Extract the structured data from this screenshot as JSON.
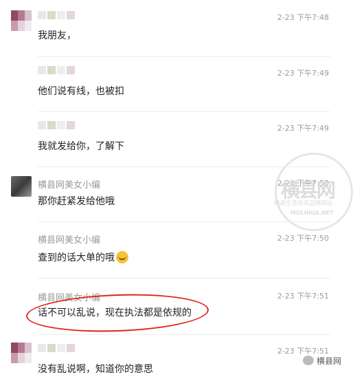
{
  "messages": [
    {
      "name": "",
      "time": "2-23 下午7:48",
      "text": "我朋友，",
      "avatar": "pixelated"
    },
    {
      "name": "",
      "time": "2-23 下午7:49",
      "text": "他们说有线，也被扣"
    },
    {
      "name": "",
      "time": "2-23 下午7:49",
      "text": "我就发给你，了解下"
    },
    {
      "name": "横县网美女小编",
      "time": "2-23 下午7:50",
      "text": "那你赶紧发给他哦",
      "avatar": "photo"
    },
    {
      "name": "横县网美女小编",
      "time": "2-23 下午7:50",
      "text": "查到的话大单的哦",
      "emoji": "laughing-crying-emoji"
    },
    {
      "name": "横县网美女小编",
      "time": "2-23 下午7:51",
      "text": "话不可以乱说，现在执法都是依规的"
    },
    {
      "name": "",
      "time": "2-23 下午7:51",
      "text": "没有乱说啊，知道你的意思",
      "avatar": "pixelated"
    }
  ],
  "watermark": {
    "main": "横县网",
    "sub": "横县生活资讯品牌网站",
    "url": "MOLIHUA.NET"
  },
  "footer": {
    "label": "横县网"
  },
  "colors": {
    "highlight_oval": "#e2231a",
    "name_gray": "#9a9a9a"
  }
}
